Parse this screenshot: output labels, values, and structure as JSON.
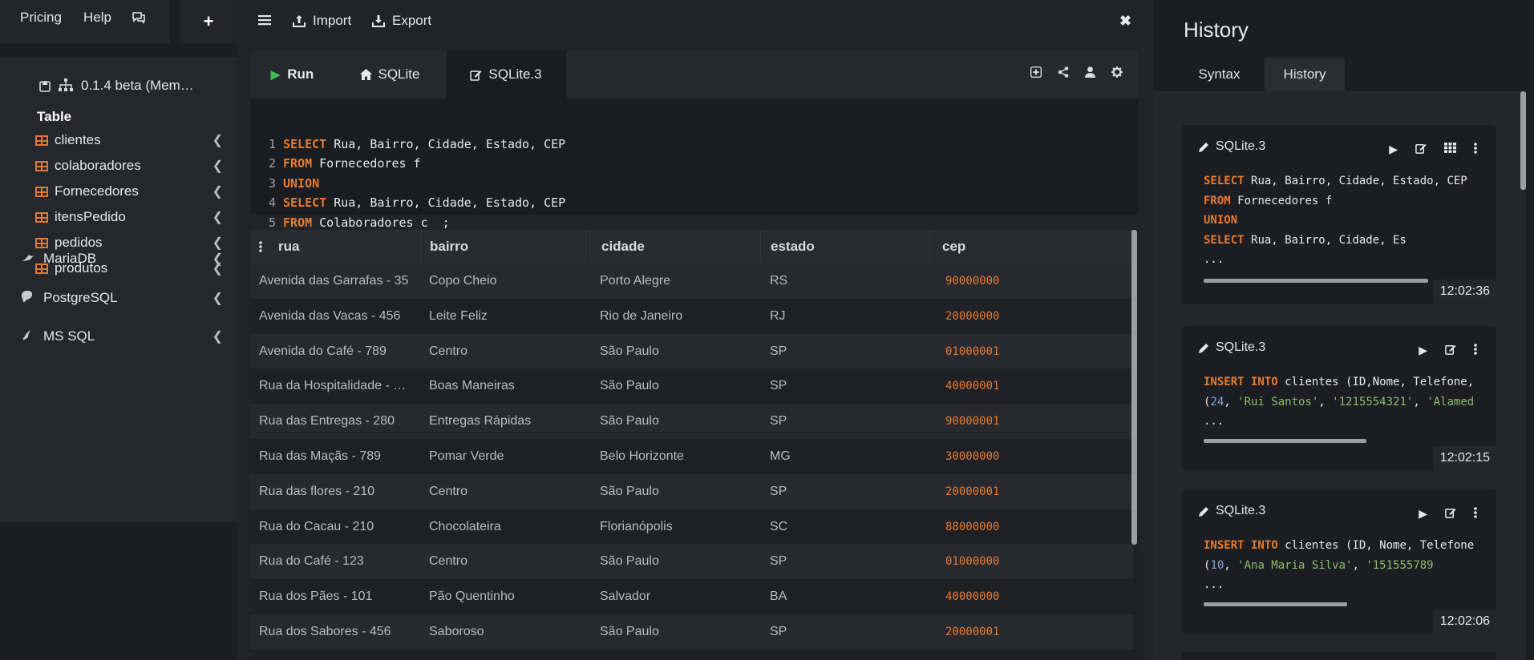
{
  "sidebar": {
    "nav": {
      "pricing": "Pricing",
      "help": "Help",
      "chat_icon": "chat-icon",
      "add_icon": "plus-icon"
    },
    "connection_label": "0.1.4 beta (Mem…",
    "table_heading": "Table",
    "tables": [
      "clientes",
      "colaboradores",
      "Fornecedores",
      "itensPedido",
      "pedidos",
      "produtos"
    ],
    "databases": [
      "MariaDB",
      "PostgreSQL",
      "MS SQL"
    ]
  },
  "toolbar": {
    "import": "Import",
    "export": "Export"
  },
  "editor": {
    "run_label": "Run",
    "tabs": [
      "SQLite",
      "SQLite.3"
    ],
    "lines": [
      "1",
      "2",
      "3",
      "4",
      "5"
    ]
  },
  "grid": {
    "columns": [
      "rua",
      "bairro",
      "cidade",
      "estado",
      "cep"
    ],
    "rows": [
      [
        "Avenida das Garrafas - 35",
        "Copo Cheio",
        "Porto Alegre",
        "RS",
        "90000000"
      ],
      [
        "Avenida das Vacas - 456",
        "Leite Feliz",
        "Rio de Janeiro",
        "RJ",
        "20000000"
      ],
      [
        "Avenida do Café - 789",
        "Centro",
        "São Paulo",
        "SP",
        "01000001"
      ],
      [
        "Rua da Hospitalidade - …",
        "Boas Maneiras",
        "São Paulo",
        "SP",
        "40000001"
      ],
      [
        "Rua das Entregas - 280",
        "Entregas Rápidas",
        "São Paulo",
        "SP",
        "90000001"
      ],
      [
        "Rua das Maçãs - 789",
        "Pomar Verde",
        "Belo Horizonte",
        "MG",
        "30000000"
      ],
      [
        "Rua das flores - 210",
        "Centro",
        "São Paulo",
        "SP",
        "20000001"
      ],
      [
        "Rua do Cacau - 210",
        "Chocolateira",
        "Florianópolis",
        "SC",
        "88000000"
      ],
      [
        "Rua do Café - 123",
        "Centro",
        "São Paulo",
        "SP",
        "01000000"
      ],
      [
        "Rua dos Pães - 101",
        "Pão Quentinho",
        "Salvador",
        "BA",
        "40000000"
      ],
      [
        "Rua dos Sabores - 456",
        "Saboroso",
        "São Paulo",
        "SP",
        "20000001"
      ]
    ]
  },
  "history": {
    "title": "History",
    "tabs": [
      "Syntax",
      "History"
    ],
    "entries": [
      {
        "name": "SQLite.3",
        "time": "12:02:36",
        "ellipsis": "...",
        "scroll_fraction": 0.8
      },
      {
        "name": "SQLite.3",
        "time": "12:02:15",
        "ellipsis": "...",
        "scroll_fraction": 0.58
      },
      {
        "name": "SQLite.3",
        "time": "12:02:06",
        "ellipsis": "...",
        "scroll_fraction": 0.51
      }
    ]
  },
  "colors": {
    "keyword": "#e87c2f",
    "accent_green": "#3fb950",
    "number": "#7ea6e0",
    "string": "#8bbf6a"
  }
}
